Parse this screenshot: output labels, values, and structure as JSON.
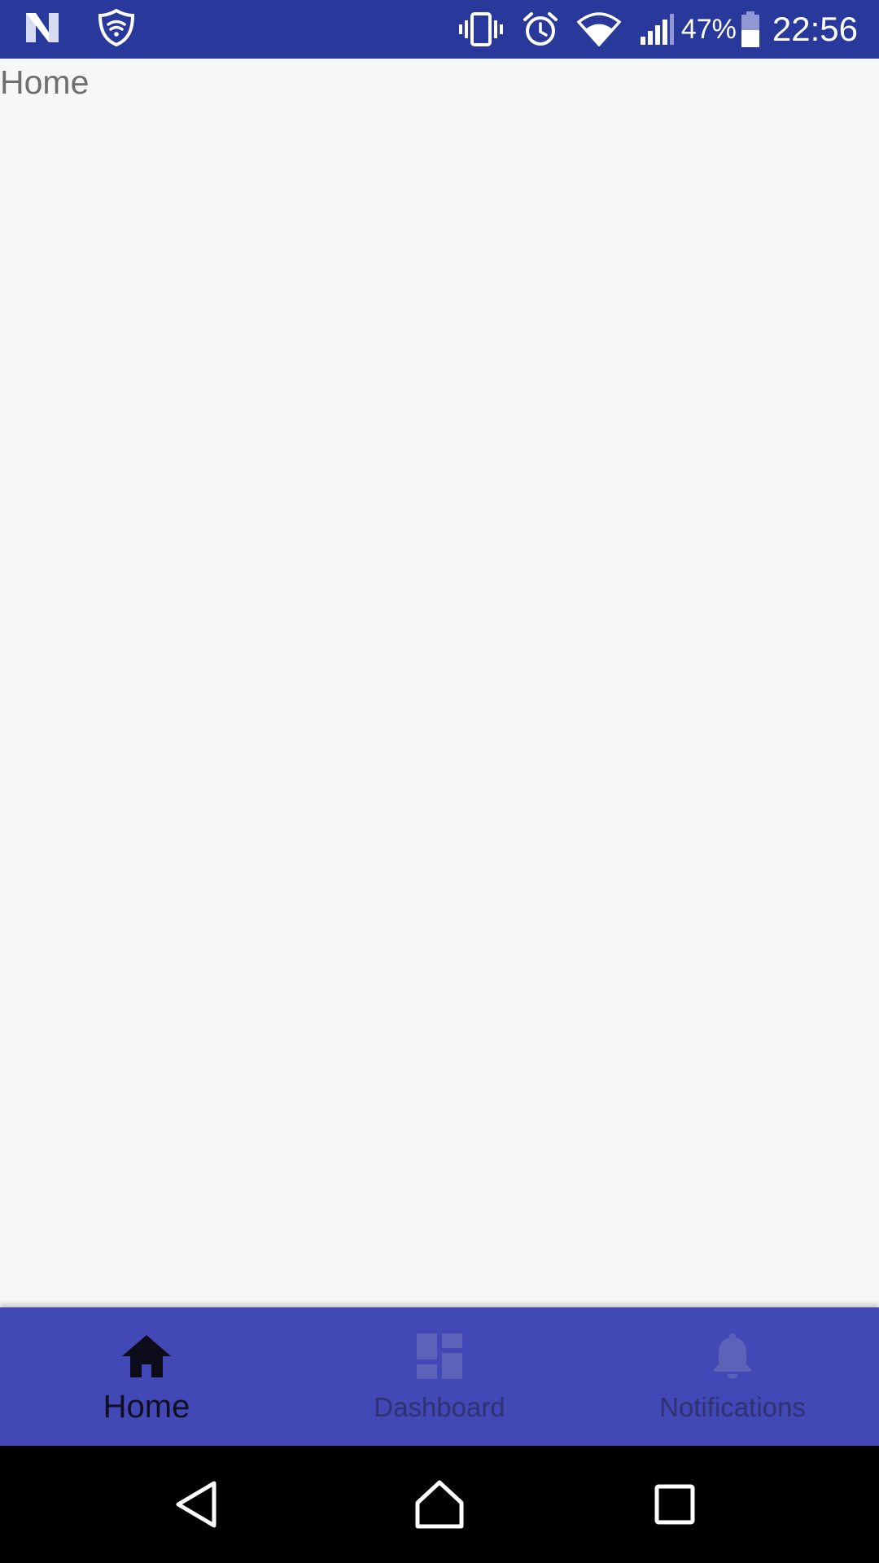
{
  "status_bar": {
    "battery_percent": "47%",
    "time": "22:56",
    "left_icons": [
      "n-logo-icon",
      "shield-icon"
    ],
    "right_icons": [
      "vibrate-icon",
      "alarm-icon",
      "wifi-icon",
      "signal-icon",
      "battery-icon"
    ]
  },
  "main": {
    "message": "Home"
  },
  "bottom_nav": {
    "items": [
      {
        "label": "Home",
        "icon": "home-icon",
        "active": true
      },
      {
        "label": "Dashboard",
        "icon": "dashboard-icon",
        "active": false
      },
      {
        "label": "Notifications",
        "icon": "bell-icon",
        "active": false
      }
    ]
  },
  "system_nav": {
    "buttons": [
      "back-icon",
      "home-circle-icon",
      "recents-icon"
    ]
  },
  "colors": {
    "status_bar": "#28389b",
    "bottom_nav": "#4248b5",
    "background": "#f7f7f7"
  }
}
